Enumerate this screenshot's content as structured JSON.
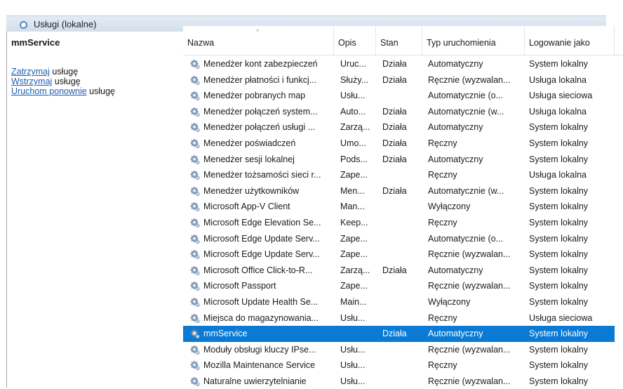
{
  "window": {
    "title": "Usługi (lokalne)"
  },
  "left_panel": {
    "service_name": "mmService",
    "actions": [
      {
        "link": "Zatrzymaj",
        "rest": " usługę"
      },
      {
        "link": "Wstrzymaj",
        "rest": " usługę"
      },
      {
        "link": "Uruchom ponownie",
        "rest": " usługę"
      }
    ]
  },
  "table": {
    "columns": [
      "Nazwa",
      "Opis",
      "Stan",
      "Typ uruchomienia",
      "Logowanie jako"
    ],
    "sort_indicator": "^",
    "rows": [
      {
        "name": "Menedżer kont zabezpieczeń",
        "desc": "Uruc...",
        "status": "Działa",
        "startup": "Automatyczny",
        "logon": "System lokalny"
      },
      {
        "name": "Menedżer płatności i funkcj...",
        "desc": "Służy...",
        "status": "Działa",
        "startup": "Ręcznie (wyzwalan...",
        "logon": "Usługa lokalna"
      },
      {
        "name": "Menedżer pobranych map",
        "desc": "Usłu...",
        "status": "",
        "startup": "Automatycznie (o...",
        "logon": "Usługa sieciowa"
      },
      {
        "name": "Menedżer połączeń system...",
        "desc": "Auto...",
        "status": "Działa",
        "startup": "Automatycznie (w...",
        "logon": "Usługa lokalna"
      },
      {
        "name": "Menedżer połączeń usługi ...",
        "desc": "Zarzą...",
        "status": "Działa",
        "startup": "Automatyczny",
        "logon": "System lokalny"
      },
      {
        "name": "Menedżer poświadczeń",
        "desc": "Umo...",
        "status": "Działa",
        "startup": "Ręczny",
        "logon": "System lokalny"
      },
      {
        "name": "Menedżer sesji lokalnej",
        "desc": "Pods...",
        "status": "Działa",
        "startup": "Automatyczny",
        "logon": "System lokalny"
      },
      {
        "name": "Menedżer tożsamości sieci r...",
        "desc": "Zape...",
        "status": "",
        "startup": "Ręczny",
        "logon": "Usługa lokalna"
      },
      {
        "name": "Menedżer użytkowników",
        "desc": "Men...",
        "status": "Działa",
        "startup": "Automatycznie (w...",
        "logon": "System lokalny"
      },
      {
        "name": "Microsoft App-V Client",
        "desc": "Man...",
        "status": "",
        "startup": "Wyłączony",
        "logon": "System lokalny"
      },
      {
        "name": "Microsoft Edge Elevation Se...",
        "desc": "Keep...",
        "status": "",
        "startup": "Ręczny",
        "logon": "System lokalny"
      },
      {
        "name": "Microsoft Edge Update Serv...",
        "desc": "Zape...",
        "status": "",
        "startup": "Automatycznie (o...",
        "logon": "System lokalny"
      },
      {
        "name": "Microsoft Edge Update Serv...",
        "desc": "Zape...",
        "status": "",
        "startup": "Ręcznie (wyzwalan...",
        "logon": "System lokalny"
      },
      {
        "name": "Microsoft Office Click-to-R...",
        "desc": "Zarzą...",
        "status": "Działa",
        "startup": "Automatyczny",
        "logon": "System lokalny"
      },
      {
        "name": "Microsoft Passport",
        "desc": "Zape...",
        "status": "",
        "startup": "Ręcznie (wyzwalan...",
        "logon": "System lokalny"
      },
      {
        "name": "Microsoft Update Health Se...",
        "desc": "Main...",
        "status": "",
        "startup": "Wyłączony",
        "logon": "System lokalny"
      },
      {
        "name": "Miejsca do magazynowania...",
        "desc": "Usłu...",
        "status": "",
        "startup": "Ręczny",
        "logon": "Usługa sieciowa"
      },
      {
        "name": "mmService",
        "desc": "",
        "status": "Działa",
        "startup": "Automatyczny",
        "logon": "System lokalny",
        "selected": true
      },
      {
        "name": "Moduły obsługi kluczy IPse...",
        "desc": "Usłu...",
        "status": "",
        "startup": "Ręcznie (wyzwalan...",
        "logon": "System lokalny"
      },
      {
        "name": "Mozilla Maintenance Service",
        "desc": "Usłu...",
        "status": "",
        "startup": "Ręczny",
        "logon": "System lokalny"
      },
      {
        "name": "Naturalne uwierzytelnianie",
        "desc": "Usłu...",
        "status": "",
        "startup": "Ręcznie (wyzwalan...",
        "logon": "System lokalny"
      }
    ]
  },
  "colors": {
    "selection": "#0a7ad4",
    "link": "#1a5fb4"
  },
  "icons": {
    "service": "gear-icon"
  }
}
